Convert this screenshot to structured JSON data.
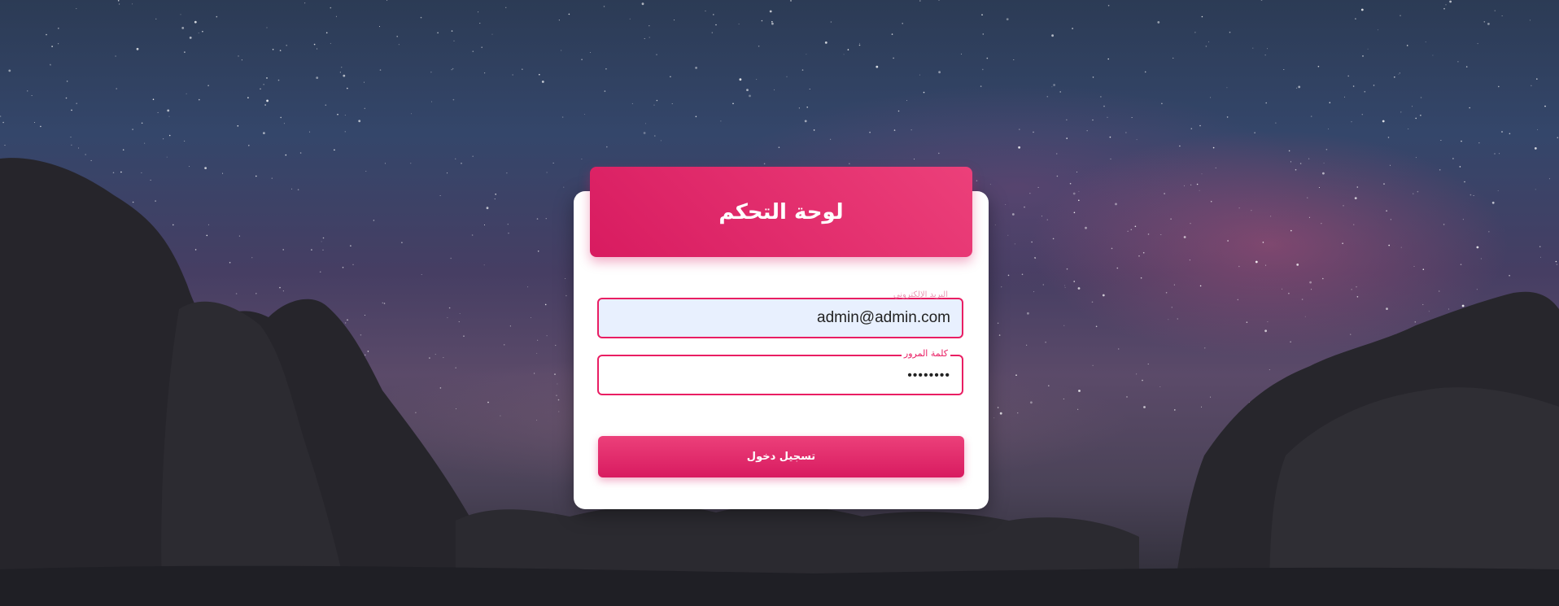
{
  "login": {
    "title": "لوحة التحكم",
    "email": {
      "label": "البريد الإلكتروني",
      "value": "admin@admin.com"
    },
    "password": {
      "label": "كلمة المرور",
      "value": "••••••••"
    },
    "submit_label": "تسجيل دخول"
  },
  "colors": {
    "accent": "#e91e63",
    "header_gradient_start": "#d81b60",
    "header_gradient_end": "#ec407a",
    "autofill_background": "#e8f0fe"
  }
}
